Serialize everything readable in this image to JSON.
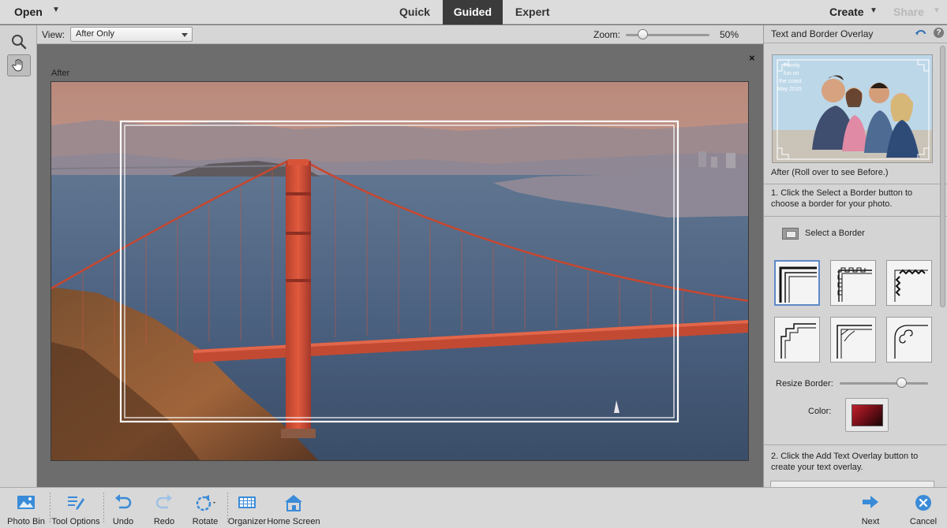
{
  "topbar": {
    "open_label": "Open",
    "tabs": [
      {
        "label": "Quick"
      },
      {
        "label": "Guided",
        "active": true
      },
      {
        "label": "Expert"
      }
    ],
    "create_label": "Create",
    "share_label": "Share"
  },
  "toolbox": {
    "tools": [
      {
        "icon": "zoom-icon",
        "active": false
      },
      {
        "icon": "hand-icon",
        "active": true
      }
    ]
  },
  "options_bar": {
    "view_label": "View:",
    "view_value": "After Only",
    "zoom_label": "Zoom:",
    "zoom_value": "50%",
    "zoom_level": 0.2
  },
  "canvas": {
    "close_label": "×",
    "after_label": "After"
  },
  "panel": {
    "title": "Text and Border Overlay",
    "preview_text": [
      "Family",
      "fun on",
      "the coast",
      "May 2015"
    ],
    "caption": "After (Roll over to see Before.)",
    "step1": "1. Click the Select a Border button to choose a border for your photo.",
    "select_border_label": "Select a Border",
    "resize_label": "Resize Border:",
    "resize_level": 0.7,
    "color_label": "Color:",
    "color_value": "#a3141f",
    "step2": "2. Click the Add Text Overlay button to create your text overlay."
  },
  "bottombar": {
    "photo_bin": "Photo Bin",
    "tool_options": "Tool Options",
    "undo": "Undo",
    "redo": "Redo",
    "rotate": "Rotate",
    "organizer": "Organizer",
    "home_screen": "Home Screen",
    "next": "Next",
    "cancel": "Cancel"
  },
  "colors": {
    "accent": "#3a8bd8",
    "active_tab_bg": "#3b3b3b",
    "bridge": "#d8462e"
  }
}
